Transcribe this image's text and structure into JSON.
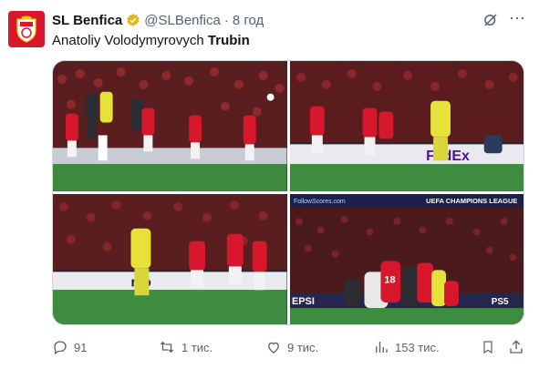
{
  "account": {
    "name": "SL Benfica",
    "handle": "@SLBenfica",
    "time": "8 год",
    "avatar_icon": "benfica-crest-icon",
    "brand_color": "#d7172b"
  },
  "post": {
    "text_prefix": "Anatoliy Volodymyrovych ",
    "text_bold": "Trubin"
  },
  "media": {
    "photos": [
      {
        "desc": "Players jumping for a header in front of goal"
      },
      {
        "desc": "Goalkeeper in yellow celebrating with red-shirted players"
      },
      {
        "desc": "Goalkeeper and teammates running to celebrate"
      },
      {
        "desc": "Team piled together celebrating on the pitch"
      }
    ],
    "board_texts": {
      "p2_banner": "FedEx",
      "p3_banner": "mo",
      "p4_top": "UEFA CHAMPIONS LEAGUE",
      "p4_left": "EPSI",
      "p4_right": "PS5",
      "p4_site": "FollowScores.com",
      "p4_number": "18"
    }
  },
  "actions": {
    "replies": "91",
    "reposts": "1 тис.",
    "likes": "9 тис.",
    "views": "153 тис."
  },
  "colors": {
    "muted": "#536471",
    "verified": "#e2b719",
    "benfica_red": "#d7172b",
    "keeper_yellow": "#e6e23a"
  }
}
